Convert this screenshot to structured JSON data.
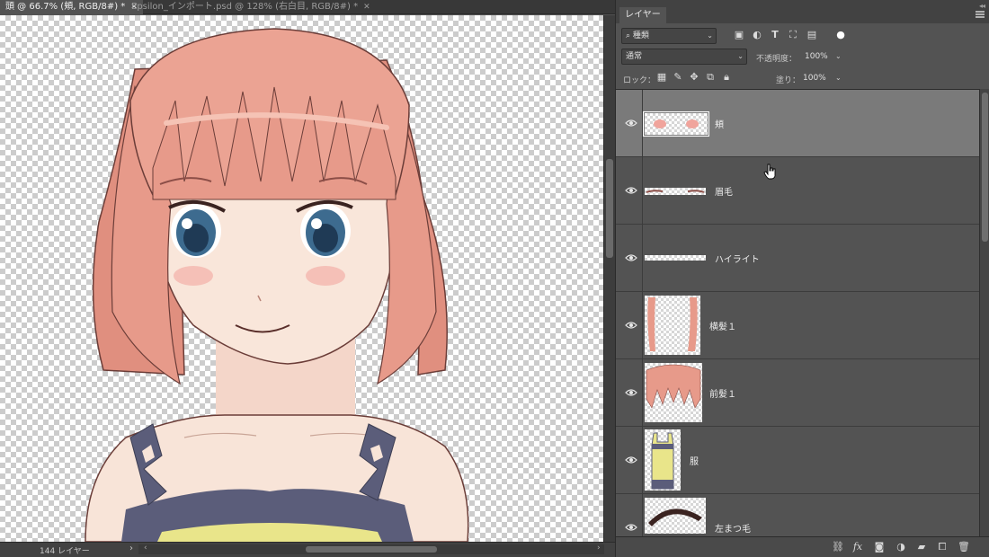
{
  "document_tabs": [
    {
      "label": "頭 @ 66.7% (頬, RGB/8#) *",
      "active": true
    },
    {
      "label": "Epsilon_インポート.psd @ 128% (右白目, RGB/8#) *",
      "active": false
    }
  ],
  "status": {
    "layer_count": "144 レイヤー"
  },
  "panel": {
    "tab_label": "レイヤー",
    "filter": {
      "kind": "種類"
    },
    "blend_mode": "通常",
    "opacity": {
      "label": "不透明度：",
      "value": "100%"
    },
    "lock": {
      "label": "ロック："
    },
    "fill": {
      "label": "塗り：",
      "value": "100%"
    }
  },
  "layers": [
    {
      "name": "頬",
      "visible": true,
      "selected": true,
      "thumb": "cheek-blush"
    },
    {
      "name": "眉毛",
      "visible": true,
      "selected": false,
      "thumb": "eyebrows"
    },
    {
      "name": "ハイライト",
      "visible": true,
      "selected": false,
      "thumb": "highlight"
    },
    {
      "name": "横髪１",
      "visible": true,
      "selected": false,
      "thumb": "side-hair"
    },
    {
      "name": "前髪１",
      "visible": true,
      "selected": false,
      "thumb": "bangs"
    },
    {
      "name": "服",
      "visible": true,
      "selected": false,
      "thumb": "clothes"
    },
    {
      "name": "左まつ毛",
      "visible": true,
      "selected": false,
      "thumb": "left-eyelash"
    }
  ],
  "colors": {
    "panel_bg": "#535353",
    "selected_layer": "#7a7a7a",
    "hair": "#e79a8a",
    "skin": "#f8e4d8",
    "eye": "#3d6b8f",
    "dress_straps": "#5b5d7a",
    "dress_yellow": "#e9e58a"
  },
  "icons": {
    "filter_search": "search-icon",
    "visibility": "eye-icon"
  }
}
